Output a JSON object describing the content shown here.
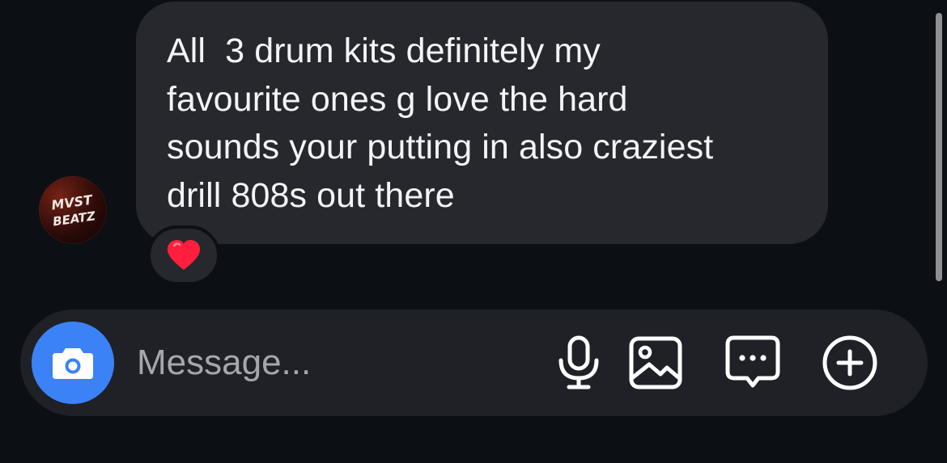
{
  "avatar": {
    "label_line1": "MVST",
    "label_line2": "BEATZ"
  },
  "message": {
    "text": "All  3 drum kits definitely my\nfavourite ones g love the hard\nsounds your putting in also craziest\ndrill 808s out there",
    "reaction_emoji": "❤️"
  },
  "composer": {
    "placeholder": "Message...",
    "camera_icon": "camera-icon",
    "mic_icon": "microphone-icon",
    "gallery_icon": "image-icon",
    "sticker_icon": "chat-bubble-icon",
    "more_icon": "plus-circle-icon"
  },
  "colors": {
    "background": "#0c0f14",
    "bubble": "#26282e",
    "composer": "#1f2127",
    "camera_button": "#3b82f6"
  }
}
